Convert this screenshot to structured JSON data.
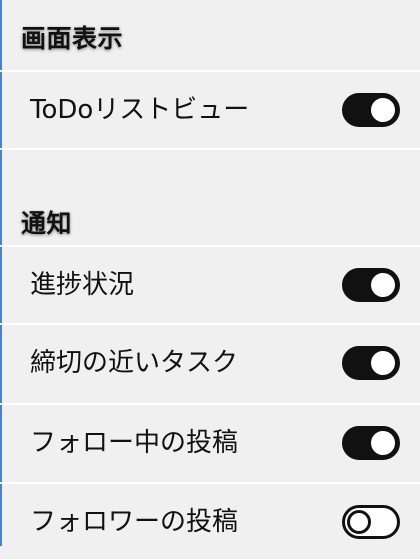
{
  "display_section": {
    "title": "画面表示",
    "items": [
      {
        "label": "ToDoリストビュー",
        "enabled": true
      }
    ]
  },
  "notification_section": {
    "title": "通知",
    "items": [
      {
        "label": "進捗状況",
        "enabled": true
      },
      {
        "label": "締切の近いタスク",
        "enabled": true
      },
      {
        "label": "フォロー中の投稿",
        "enabled": true
      },
      {
        "label": "フォロワーの投稿",
        "enabled": false
      }
    ]
  },
  "colors": {
    "background": "#f0f0f0",
    "separator": "#ffffff",
    "toggle_on": "#111111",
    "left_edge": "#3b86d8"
  },
  "icons": {
    "toggle_on": "toggle-on-icon",
    "toggle_off": "toggle-off-icon"
  }
}
